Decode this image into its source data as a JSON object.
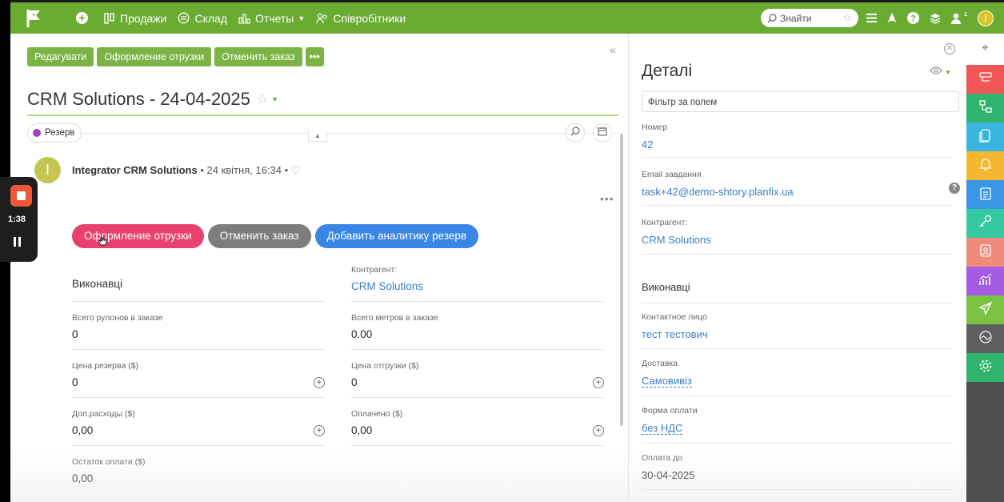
{
  "topbar": {
    "nav": [
      {
        "label": "Продажи",
        "icon": "columns-icon"
      },
      {
        "label": "Склад",
        "icon": "stock-icon"
      },
      {
        "label": "Отчеты",
        "icon": "chart-icon"
      },
      {
        "label": "Співробітники",
        "icon": "people-icon"
      }
    ],
    "search_placeholder": "Знайти",
    "avatar_letter": "I",
    "notif_count": "1"
  },
  "task": {
    "buttons": [
      "Редагувати",
      "Оформление отрузки",
      "Отменить заказ"
    ],
    "title": "CRM Solutions - 24-04-2025",
    "status": "Резерв",
    "status_color": "#a33ec7"
  },
  "comment": {
    "avatar_letter": "I",
    "author": "Integrator CRM Solutions",
    "date": "24 квітня, 16:34",
    "actions": [
      {
        "label": "Оформление отрузки",
        "color": "#e8416e"
      },
      {
        "label": "Отменить заказ",
        "color": "#7d7d7d"
      },
      {
        "label": "Добавить аналитику резерв",
        "color": "#3a86e6"
      }
    ],
    "fields": {
      "executors_label": "Виконавці",
      "contractor_label": "Контрагент:",
      "contractor_value": "CRM Solutions",
      "rolls_label": "Всего рулонов в заказе",
      "rolls_value": "0",
      "meters_label": "Всего метров в заказе",
      "meters_value": "0.00",
      "reserve_price_label": "Цена резерва ($)",
      "reserve_price_value": "0",
      "ship_price_label": "Цена отгрузки ($)",
      "ship_price_value": "0",
      "extra_label": "Доп.расходы ($)",
      "extra_value": "0,00",
      "paid_label": "Оплачено ($)",
      "paid_value": "0,00",
      "rest_label": "Остаток оплати ($)",
      "rest_value": "0,00"
    }
  },
  "details": {
    "title": "Деталі",
    "filter_placeholder": "Фільтр за полем",
    "number_label": "Номер",
    "number_value": "42",
    "email_label": "Email завдання",
    "email_value": "task+42@demo-shtory.planfix.ua",
    "contractor_label": "Контрагент:",
    "contractor_value": "CRM Solutions",
    "executors_label": "Виконавці",
    "contact_label": "Контактное лицо",
    "contact_value": "тест тестович",
    "delivery_label": "Доставка",
    "delivery_value": "Самовивіз",
    "payform_label": "Форма оплати",
    "payform_value": "без НДС",
    "paydue_label": "Оплата до",
    "paydue_value": "30-04-2025"
  },
  "rail_colors": [
    "#f05656",
    "#2fb36d",
    "#3ab5e0",
    "#f5b731",
    "#3a96e6",
    "#35c9a3",
    "#f08a7a",
    "#a45ce0",
    "#7bc142",
    "#5e5e5e",
    "#2fb36d"
  ],
  "recorder": {
    "time": "1:38"
  }
}
